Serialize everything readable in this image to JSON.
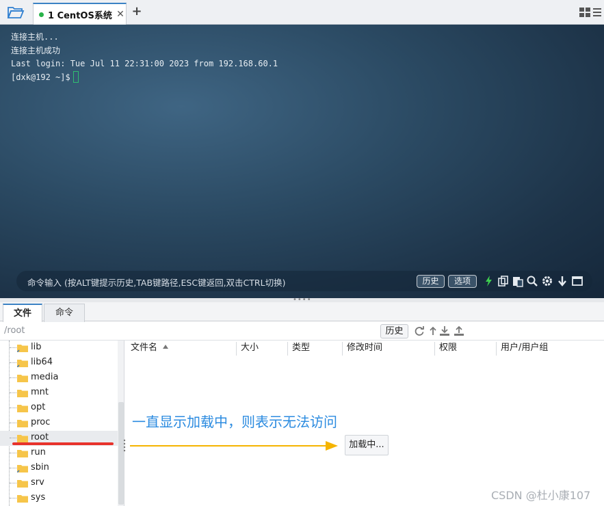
{
  "top_tabs": {
    "folder_icon": "folder-open-icon",
    "active_tab": {
      "index": "1",
      "label": "CentOS系统",
      "status_color": "#29b34a"
    },
    "close_icon": "close-icon",
    "add_icon": "plus-icon",
    "layout_icon": "grid-icon",
    "menu_icon": "menu-icon"
  },
  "terminal": {
    "lines": [
      "连接主机...",
      "连接主机成功",
      "Last login: Tue Jul 11 22:31:00 2023 from 192.168.60.1",
      "[dxk@192 ~]$"
    ],
    "command_bar": {
      "placeholder": "命令输入 (按ALT键提示历史,TAB键路径,ESC键返回,双击CTRL切换)",
      "history_label": "历史",
      "options_label": "选项",
      "icons": [
        "lightning-icon",
        "copy-icon",
        "paste-icon",
        "search-icon",
        "gear-icon",
        "arrow-down-icon",
        "maximize-icon"
      ]
    }
  },
  "lower_tabs": [
    "文件",
    "命令"
  ],
  "path_bar": {
    "path": "/root",
    "history_label": "历史",
    "icons": [
      "refresh-icon",
      "up-icon",
      "download-icon",
      "upload-icon"
    ]
  },
  "tree": {
    "items": [
      "lib",
      "lib64",
      "media",
      "mnt",
      "opt",
      "proc",
      "root",
      "run",
      "sbin",
      "srv",
      "sys"
    ],
    "selected": "root"
  },
  "file_list": {
    "columns": [
      "文件名",
      "大小",
      "类型",
      "修改时间",
      "权限",
      "用户/用户组"
    ],
    "loading_label": "加载中..."
  },
  "annotation": {
    "text": "一直显示加载中，则表示无法访问",
    "text_color": "#2b8be0",
    "arrow_color": "#f5b400",
    "underline_color": "#e8322b"
  },
  "watermark": "CSDN @杜小康107"
}
